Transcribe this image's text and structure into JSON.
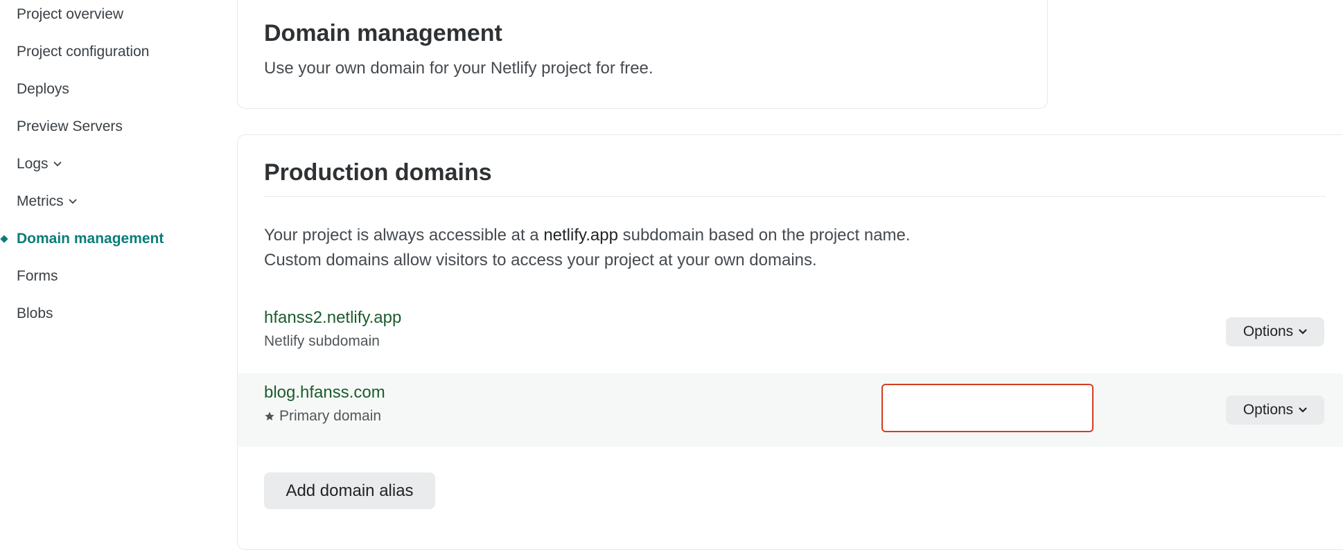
{
  "sidebar": {
    "items": [
      {
        "label": "Project overview"
      },
      {
        "label": "Project configuration"
      },
      {
        "label": "Deploys"
      },
      {
        "label": "Preview Servers"
      },
      {
        "label": "Logs",
        "has_chevron": true
      },
      {
        "label": "Metrics",
        "has_chevron": true
      },
      {
        "label": "Domain management",
        "active": true
      },
      {
        "label": "Forms"
      },
      {
        "label": "Blobs"
      }
    ],
    "accent_color": "#0a7c78"
  },
  "domain_management": {
    "title": "Domain management",
    "subtitle": "Use your own domain for your Netlify project for free."
  },
  "production_domains": {
    "title": "Production domains",
    "desc_line1_pre": "Your project is always accessible at a ",
    "desc_line1_code": "netlify.app",
    "desc_line1_post": " subdomain based on the project name.",
    "desc_line2": "Custom domains allow visitors to access your project at your own domains.",
    "domains": [
      {
        "name": "hfanss2.netlify.app",
        "type": "Netlify subdomain",
        "options_label": "Options"
      },
      {
        "name": "blog.hfanss.com",
        "type": "Primary domain",
        "icon": "star-icon",
        "options_label": "Options"
      }
    ],
    "add_alias_label": "Add domain alias",
    "link_color": "#1c5c2c",
    "highlight_color": "#d53b1f"
  }
}
